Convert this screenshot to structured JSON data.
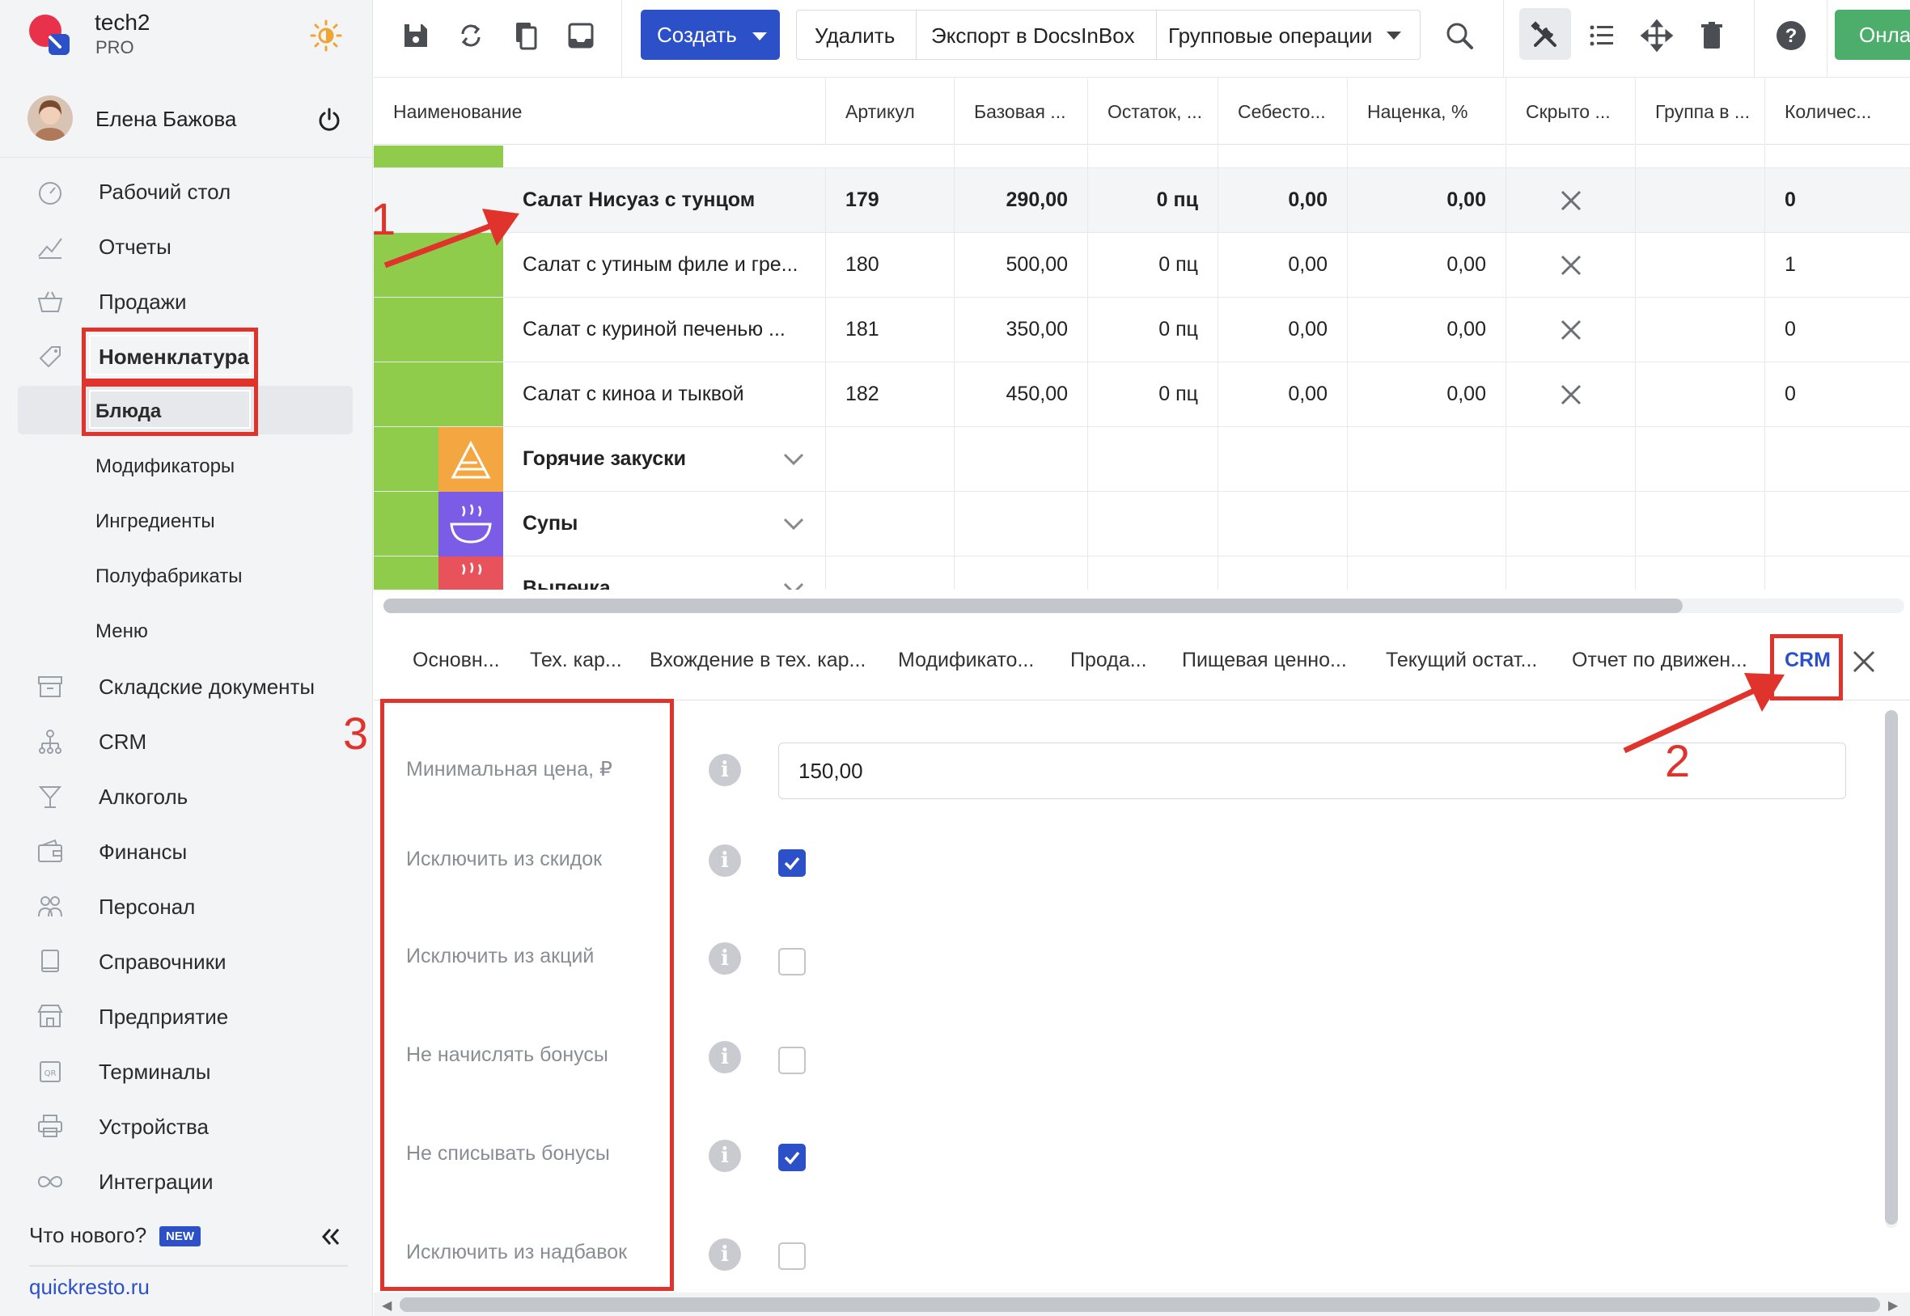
{
  "brand": {
    "name": "tech2",
    "plan": "PRO"
  },
  "user": {
    "name": "Елена Бажова"
  },
  "sidebar": {
    "items": [
      {
        "label": "Рабочий стол",
        "icon": "dashboard-icon"
      },
      {
        "label": "Отчеты",
        "icon": "reports-icon"
      },
      {
        "label": "Продажи",
        "icon": "basket-icon"
      },
      {
        "label": "Номенклатура",
        "icon": "tag-icon"
      },
      {
        "label": "Блюда"
      },
      {
        "label": "Модификаторы"
      },
      {
        "label": "Ингредиенты"
      },
      {
        "label": "Полуфабрикаты"
      },
      {
        "label": "Меню"
      },
      {
        "label": "Складские документы",
        "icon": "warehouse-icon"
      },
      {
        "label": "CRM",
        "icon": "crm-icon"
      },
      {
        "label": "Алкоголь",
        "icon": "cocktail-icon"
      },
      {
        "label": "Финансы",
        "icon": "wallet-icon"
      },
      {
        "label": "Персонал",
        "icon": "staff-icon"
      },
      {
        "label": "Справочники",
        "icon": "book-icon"
      },
      {
        "label": "Предприятие",
        "icon": "store-icon"
      },
      {
        "label": "Терминалы",
        "icon": "qr-icon"
      },
      {
        "label": "Устройства",
        "icon": "printer-icon"
      },
      {
        "label": "Интеграции",
        "icon": "infinity-icon"
      }
    ],
    "whats_new": "Что нового?",
    "new_badge": "NEW",
    "site_link": "quickresto.ru"
  },
  "toolbar": {
    "create_label": "Создать",
    "delete_label": "Удалить",
    "export_label": "Экспорт в DocsInBox",
    "group_ops_label": "Групповые операции",
    "online_label": "Онлайн"
  },
  "table": {
    "columns": [
      "Наименование",
      "Артикул",
      "Базовая ...",
      "Остаток, ...",
      "Себесто...",
      "Наценка, %",
      "Скрыто ...",
      "Группа в ...",
      "Количес..."
    ],
    "rows": [
      {
        "name": "Салат Нисуаз с тунцом",
        "article": "179",
        "price": "290,00",
        "stock": "0 пц",
        "cost": "0,00",
        "markup": "0,00",
        "hidden": "×",
        "group": "",
        "qty": "0"
      },
      {
        "name": "Салат с утиным филе и гре...",
        "article": "180",
        "price": "500,00",
        "stock": "0 пц",
        "cost": "0,00",
        "markup": "0,00",
        "hidden": "×",
        "group": "",
        "qty": "1"
      },
      {
        "name": "Салат с куриной печенью ...",
        "article": "181",
        "price": "350,00",
        "stock": "0 пц",
        "cost": "0,00",
        "markup": "0,00",
        "hidden": "×",
        "group": "",
        "qty": "0"
      },
      {
        "name": "Салат с киноа и тыквой",
        "article": "182",
        "price": "450,00",
        "stock": "0 пц",
        "cost": "0,00",
        "markup": "0,00",
        "hidden": "×",
        "group": "",
        "qty": "0"
      }
    ],
    "categories": [
      {
        "name": "Горячие закуски",
        "color": "#f4a640"
      },
      {
        "name": "Супы",
        "color": "#7b5ce6"
      },
      {
        "name": "Выпечка",
        "color": "#e8525a"
      }
    ],
    "group_color": "#8fcc4b"
  },
  "tabs": [
    "Основн...",
    "Тех. кар...",
    "Вхождение в тех. кар...",
    "Модификато...",
    "Прода...",
    "Пищевая ценно...",
    "Текущий остат...",
    "Отчет по движен...",
    "CRM"
  ],
  "active_tab": "CRM",
  "form": {
    "min_price_label": "Минимальная цена, ₽",
    "min_price_value": "150,00",
    "fields": [
      {
        "label": "Исключить из скидок",
        "checked": true
      },
      {
        "label": "Исключить из акций",
        "checked": false
      },
      {
        "label": "Не начислять бонусы",
        "checked": false
      },
      {
        "label": "Не списывать бонусы",
        "checked": true
      },
      {
        "label": "Исключить из надбавок",
        "checked": false
      }
    ]
  },
  "annotations": {
    "one": "1",
    "two": "2",
    "three": "3",
    "color": "#e0332b"
  },
  "colors": {
    "accent": "#2b50c8",
    "online": "#4cae6a"
  }
}
